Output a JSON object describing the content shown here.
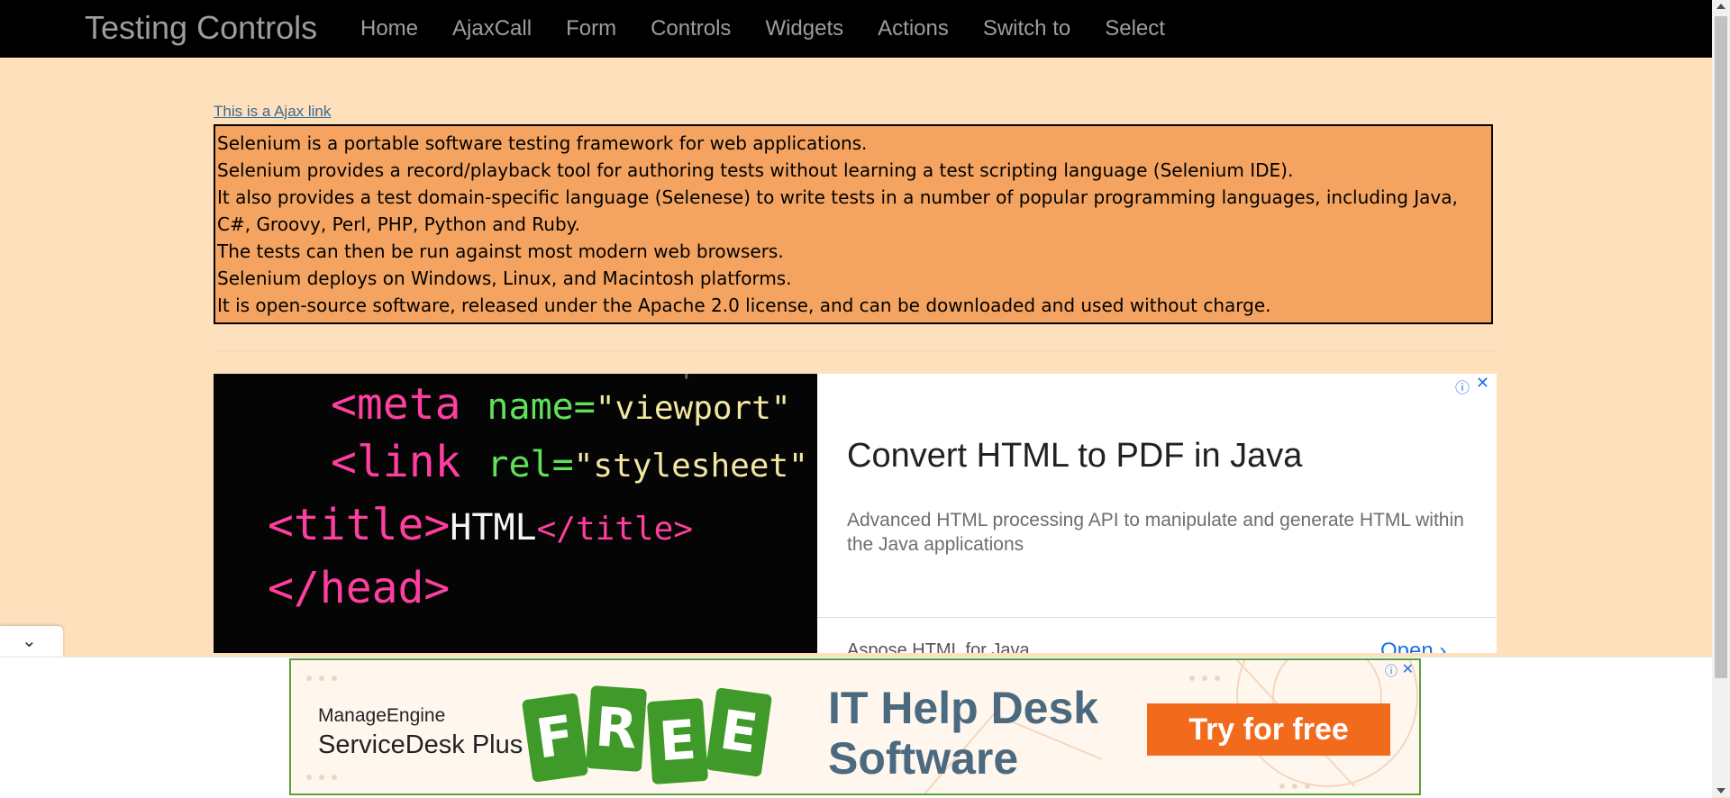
{
  "navbar": {
    "brand": "Testing Controls",
    "links": [
      "Home",
      "AjaxCall",
      "Form",
      "Controls",
      "Widgets",
      "Actions",
      "Switch to",
      "Select"
    ]
  },
  "content": {
    "ajax_link": "This is a Ajax link",
    "paragraphs": [
      "Selenium is a portable software testing framework for web applications.",
      "Selenium provides a record/playback tool for authoring tests without learning a test scripting language (Selenium IDE).",
      "It also provides a test domain-specific language (Selenese) to write tests in a number of popular programming languages, including Java, C#, Groovy, Perl, PHP, Python and Ruby.",
      "The tests can then be run against most modern web browsers.",
      "Selenium deploys on Windows, Linux, and Macintosh platforms.",
      "It is open-source software, released under the Apache 2.0 license, and can be downloaded and used without charge."
    ]
  },
  "ad_main": {
    "headline": "Convert HTML to PDF in Java",
    "description": "Advanced HTML processing API to manipulate and generate HTML within the Java applications",
    "advertiser": "Aspose.HTML for Java",
    "cta": "Open",
    "choices_icon": "info-icon",
    "close_icon": "close-icon",
    "image_code": {
      "meta_tag": "<meta",
      "meta_attr": "name=",
      "meta_val": "\"viewport\"",
      "link_tag": "<link",
      "link_attr": "rel=",
      "link_val": "\"stylesheet\"",
      "title_open": "<title>",
      "title_text": "HTML",
      "title_close": "</title>",
      "head_close": "</head>"
    }
  },
  "anchor_ad": {
    "collapse_icon": "chevron-down-icon",
    "brand_line1": "ManageEngine",
    "brand_line2": "ServiceDesk Plus",
    "free_letters": [
      "F",
      "R",
      "E",
      "E"
    ],
    "headline_line1": "IT Help Desk",
    "headline_line2": "Software",
    "cta": "Try for free"
  },
  "colors": {
    "page_bg": "#ffe0bd",
    "info_box_bg": "#f4a460",
    "navbar_bg": "#000000",
    "cta_orange": "#f26b1d",
    "link_blue": "#1a73e8"
  }
}
